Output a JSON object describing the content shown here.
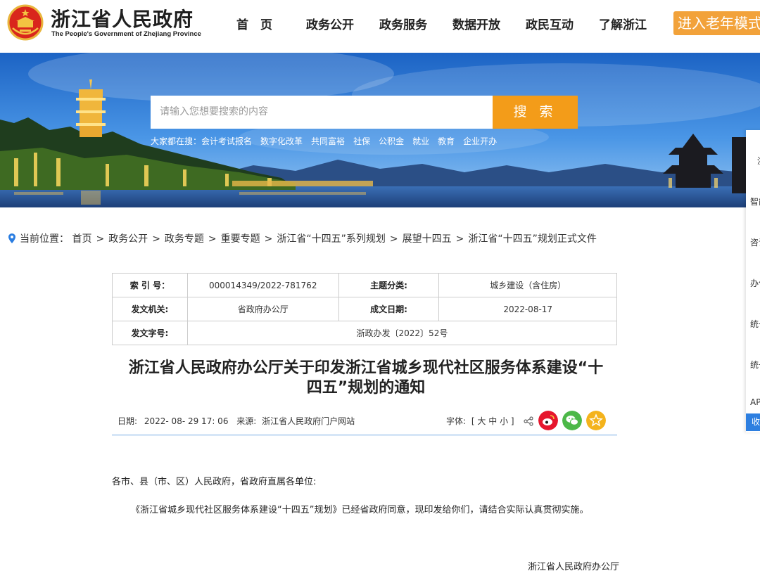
{
  "header": {
    "title": "浙江省人民政府",
    "subtitle": "The People's Government of Zhejiang Province",
    "nav": [
      "首　页",
      "政务公开",
      "政务服务",
      "数据开放",
      "政民互动",
      "了解浙江"
    ],
    "elder_mode": "进入老年模式"
  },
  "search": {
    "placeholder": "请输入您想要搜索的内容",
    "button": "搜 索",
    "hot_label": "大家都在搜：",
    "hot_items": [
      "会计考试报名",
      "数字化改革",
      "共同富裕",
      "社保",
      "公积金",
      "就业",
      "教育",
      "企业开办"
    ]
  },
  "side_panel": {
    "items": [
      "浙",
      "智能",
      "咨询",
      "办件",
      "统一",
      "统一",
      "AP"
    ],
    "collapse": "收"
  },
  "breadcrumb": {
    "label": "当前位置：",
    "items": [
      "首页",
      "政务公开",
      "政务专题",
      "重要专题",
      "浙江省“十四五”系列规划",
      "展望十四五",
      "浙江省“十四五”规划正式文件"
    ]
  },
  "meta": {
    "index_label": "索 引 号：",
    "index_value": "000014349/2022-781762",
    "topic_label": "主题分类:",
    "topic_value": "城乡建设（含住房）",
    "issuer_label": "发文机关:",
    "issuer_value": "省政府办公厅",
    "date_label": "成文日期:",
    "date_value": "2022-08-17",
    "docno_label": "发文字号:",
    "docno_value": "浙政办发〔2022〕52号"
  },
  "article": {
    "title": "浙江省人民政府办公厅关于印发浙江省城乡现代社区服务体系建设“十四五”规划的通知",
    "date_label": "日期:",
    "date": "2022- 08- 29 17: 06",
    "source_label": "来源:",
    "source": "浙江省人民政府门户网站",
    "font_label": "字体:",
    "font_open": "[",
    "font_large": "大",
    "font_medium": "中",
    "font_small": "小",
    "font_close": "]",
    "salutation": "各市、县（市、区）人民政府，省政府直属各单位:",
    "paragraph1": "《浙江省城乡现代社区服务体系建设“十四五”规划》已经省政府同意，现印发给你们，请结合实际认真贯彻实施。",
    "signature": "浙江省人民政府办公厅"
  },
  "colors": {
    "accent_orange": "#f39c19",
    "weibo_red": "#e6162d",
    "wechat_green": "#4cb848",
    "favorite_yellow": "#f4b31c",
    "divider_blue": "#d6e6f7"
  }
}
